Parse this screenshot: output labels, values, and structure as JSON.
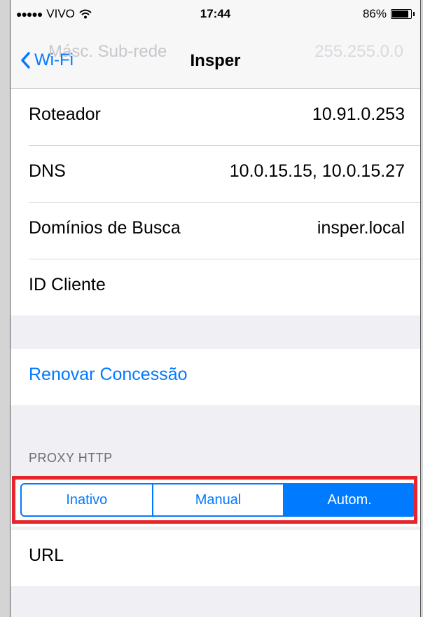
{
  "status_bar": {
    "carrier": "VIVO",
    "time": "17:44",
    "battery": "86%"
  },
  "nav": {
    "back_label": "Wi-Fi",
    "title": "Insper",
    "ghost_left": "Másc. Sub-rede",
    "ghost_right": "255.255.0.0"
  },
  "info_rows": [
    {
      "label": "Roteador",
      "value": "10.91.0.253"
    },
    {
      "label": "DNS",
      "value": "10.0.15.15, 10.0.15.27"
    },
    {
      "label": "Domínios de Busca",
      "value": "insper.local"
    },
    {
      "label": "ID Cliente",
      "value": ""
    }
  ],
  "renew": {
    "label": "Renovar Concessão"
  },
  "proxy": {
    "header": "PROXY HTTP",
    "options": [
      "Inativo",
      "Manual",
      "Autom."
    ],
    "selected": "Autom."
  },
  "url": {
    "label": "URL"
  },
  "colors": {
    "accent": "#007aff",
    "highlight": "#e5262c",
    "background": "#efeff4"
  }
}
